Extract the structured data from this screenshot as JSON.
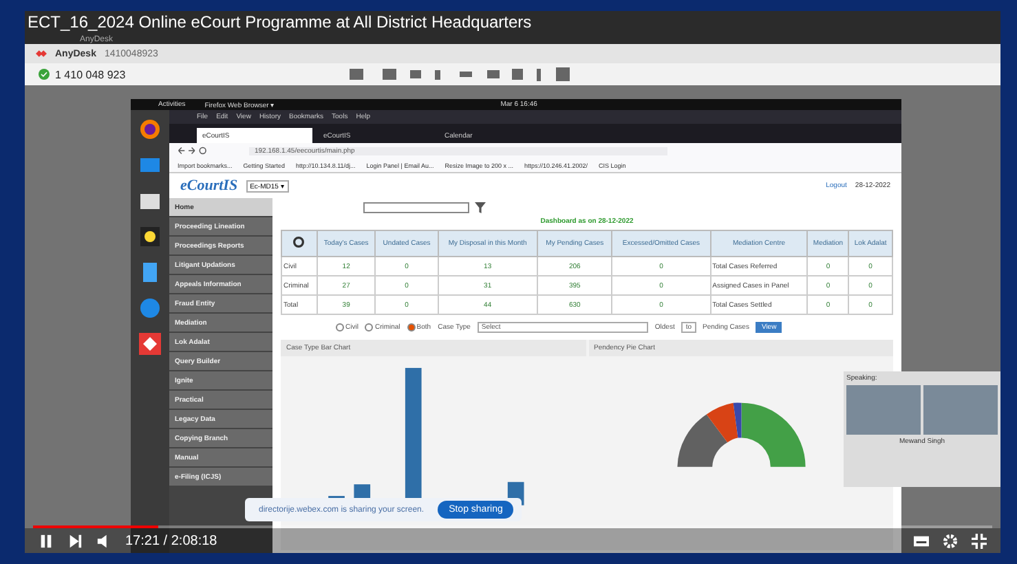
{
  "video": {
    "title": "ECT_16_2024 Online eCourt Programme at All District Headquarters",
    "time": "17:21 / 2:08:18",
    "progress": {
      "level": 0.13
    }
  },
  "anydesk": {
    "window_title": "AnyDesk",
    "tabs": [
      {
        "label": "AnyDesk",
        "selected": true
      },
      {
        "label": "1410048923",
        "selected": false
      }
    ],
    "address": "1 410 048 923"
  },
  "desktop": {
    "activities": "Activities",
    "app_menu": "Firefox Web Browser ▾",
    "clock": "Mar 6 16:46"
  },
  "firefox": {
    "menu": [
      "File",
      "Edit",
      "View",
      "History",
      "Bookmarks",
      "Tools",
      "Help"
    ],
    "tabs": [
      {
        "label": "eCourtIS",
        "selected": true
      },
      {
        "label": "eCourtIS",
        "selected": false
      },
      {
        "label": "Calendar",
        "selected": false
      }
    ],
    "url": "192.168.1.45/eecourtis/main.php",
    "bookmarks": [
      "Import bookmarks...",
      "Getting Started",
      "http://10.134.8.11/dj...",
      "Login Panel | Email Au...",
      "Resize Image to 200 x ...",
      "https://10.246.41.2002/",
      "CIS Login"
    ]
  },
  "ecourtis": {
    "logo": "eCourtIS",
    "establishment": "Ec-MD15 ▾",
    "logout": "Logout",
    "date": "28-12-2022",
    "sidebar": [
      {
        "label": "Home",
        "selected": true
      },
      {
        "label": "Proceeding Lineation",
        "selected": false
      },
      {
        "label": "Proceedings Reports",
        "selected": false
      },
      {
        "label": "Litigant Updations",
        "selected": false
      },
      {
        "label": "Appeals Information",
        "selected": false
      },
      {
        "label": "Fraud Entity",
        "selected": false
      },
      {
        "label": "Mediation",
        "selected": false
      },
      {
        "label": "Lok Adalat",
        "selected": false
      },
      {
        "label": "Query Builder",
        "selected": false
      },
      {
        "label": "Ignite",
        "selected": false
      },
      {
        "label": "Practical",
        "selected": false
      },
      {
        "label": "Legacy Data",
        "selected": false
      },
      {
        "label": "Copying Branch",
        "selected": false
      },
      {
        "label": "Manual",
        "selected": false
      },
      {
        "label": "e-Filing (ICJS)",
        "selected": false
      }
    ],
    "dashboard_title": "Dashboard as on 28-12-2022",
    "columns": [
      "",
      "Today's Cases",
      "Undated Cases",
      "My Disposal in this Month",
      "My Pending Cases",
      "Excessed/Omitted Cases",
      "Mediation Centre",
      "Mediation",
      "Lok Adalat"
    ],
    "rows": [
      [
        "Civil",
        "12",
        "0",
        "13",
        "206",
        "0",
        "Total Cases Referred",
        "0",
        "0"
      ],
      [
        "Criminal",
        "27",
        "0",
        "31",
        "395",
        "0",
        "Assigned Cases in Panel",
        "0",
        "0"
      ],
      [
        "Total",
        "39",
        "0",
        "44",
        "630",
        "0",
        "Total Cases Settled",
        "0",
        "0"
      ]
    ],
    "filters": [
      {
        "label": "Civil",
        "selected": false
      },
      {
        "label": "Criminal",
        "selected": false
      },
      {
        "label": "Both",
        "selected": true
      }
    ],
    "case_type_label": "Case Type",
    "case_type_value": "Select",
    "oldest_label": "Oldest",
    "oldest_value": "to",
    "pending_label": "Pending Cases",
    "view_button": "View",
    "charts": [
      "Case Type Bar Chart",
      "Pendency Pie Chart"
    ]
  },
  "webex": {
    "speaking_label": "Speaking:",
    "participant": "Mewand Singh",
    "share_message": "directorije.webex.com is sharing your screen.",
    "stop_button": "Stop sharing"
  }
}
